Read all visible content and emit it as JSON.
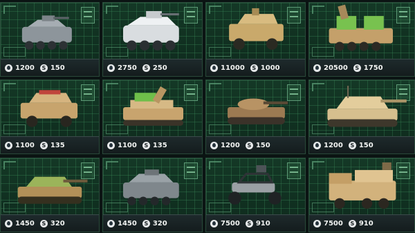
{
  "shop": {
    "items": [
      {
        "vehicle": "wheeled-apc",
        "fuel": "1200",
        "coins": "150"
      },
      {
        "vehicle": "white-armored-apc",
        "fuel": "2750",
        "coins": "250"
      },
      {
        "vehicle": "desert-humvee",
        "fuel": "11000",
        "coins": "1000"
      },
      {
        "vehicle": "desert-rocket-launcher",
        "fuel": "20500",
        "coins": "1750"
      },
      {
        "vehicle": "armored-suv",
        "fuel": "1100",
        "coins": "135"
      },
      {
        "vehicle": "desert-missile-tank",
        "fuel": "1100",
        "coins": "135"
      },
      {
        "vehicle": "camo-tank",
        "fuel": "1200",
        "coins": "150"
      },
      {
        "vehicle": "heavy-desert-tank",
        "fuel": "1200",
        "coins": "150"
      },
      {
        "vehicle": "camo-battle-tank",
        "fuel": "1450",
        "coins": "320"
      },
      {
        "vehicle": "grey-wheeled-apc",
        "fuel": "1450",
        "coins": "320"
      },
      {
        "vehicle": "grey-buggy",
        "fuel": "7500",
        "coins": "910"
      },
      {
        "vehicle": "desert-transport-truck",
        "fuel": "7500",
        "coins": "910"
      }
    ]
  },
  "icons": {
    "fuel": "fuel-drop-icon",
    "coin": "coin-icon",
    "coin_glyph": "S"
  },
  "colors": {
    "panel": "#143826",
    "grid": "#3c8c5a",
    "footer": "#1e2a2c",
    "desert": "#c8a66a",
    "camo_green": "#6fbf4a",
    "grey": "#8a9298"
  }
}
